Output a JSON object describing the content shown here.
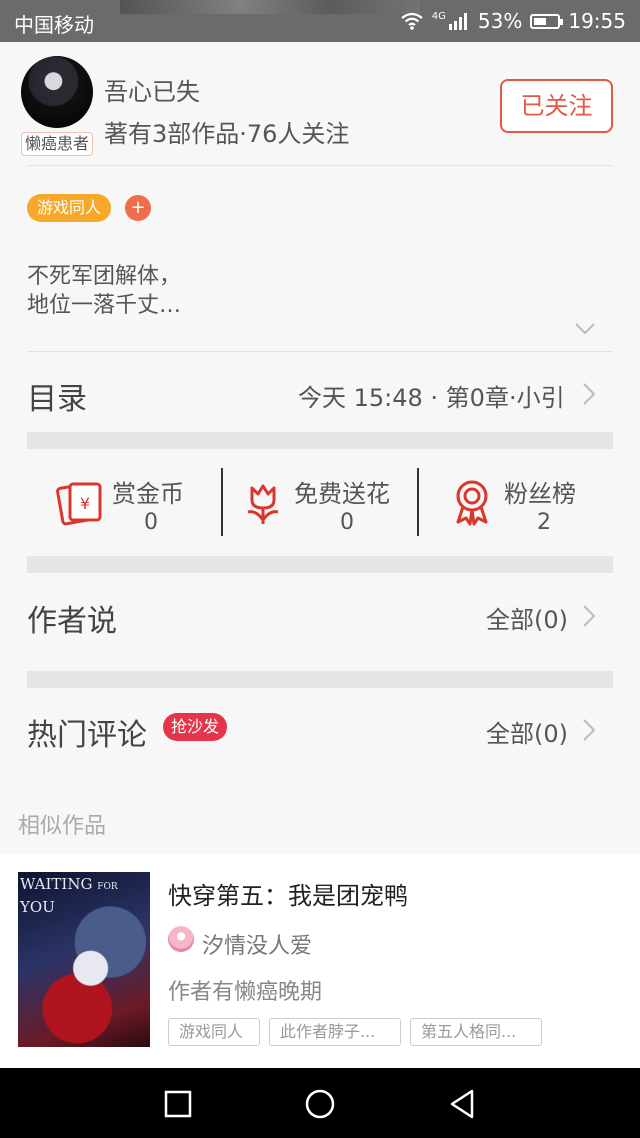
{
  "status_bar": {
    "carrier": "中国移动",
    "network": "4G",
    "battery": "53%",
    "battery_level": 0.53,
    "time": "19:55"
  },
  "author": {
    "avatar_badge": "懒癌患者",
    "name": "吾心已失",
    "stats": "著有3部作品·76人关注",
    "follow_label": "已关注"
  },
  "tags": {
    "items": [
      "游戏同人"
    ],
    "add_label": "+"
  },
  "intro": {
    "line1": "不死军团解体，",
    "line2": "地位一落千丈…"
  },
  "toc": {
    "label": "目录",
    "latest": "今天 15:48 · 第0章·小引"
  },
  "stats": [
    {
      "label": "赏金币",
      "value": "0",
      "icon": "red-envelope-icon"
    },
    {
      "label": "免费送花",
      "value": "0",
      "icon": "flower-icon"
    },
    {
      "label": "粉丝榜",
      "value": "2",
      "icon": "medal-icon"
    }
  ],
  "author_says": {
    "label": "作者说",
    "link": "全部(0)"
  },
  "hot_comments": {
    "label": "热门评论",
    "badge": "抢沙发",
    "link": "全部(0)"
  },
  "similar": {
    "title": "相似作品",
    "book": {
      "cover_text_1": "WAITING",
      "cover_text_2": "FOR",
      "cover_text_3": "YOU",
      "title": "快穿第五：我是团宠鸭",
      "author": "汐情没人爱",
      "desc": "作者有懒癌晚期",
      "tags": [
        "游戏同人",
        "此作者脖子...",
        "第五人格同..."
      ]
    }
  },
  "colors": {
    "accent": "#e05a45",
    "tag": "#f6a82a",
    "sofa": "#e5354b"
  }
}
